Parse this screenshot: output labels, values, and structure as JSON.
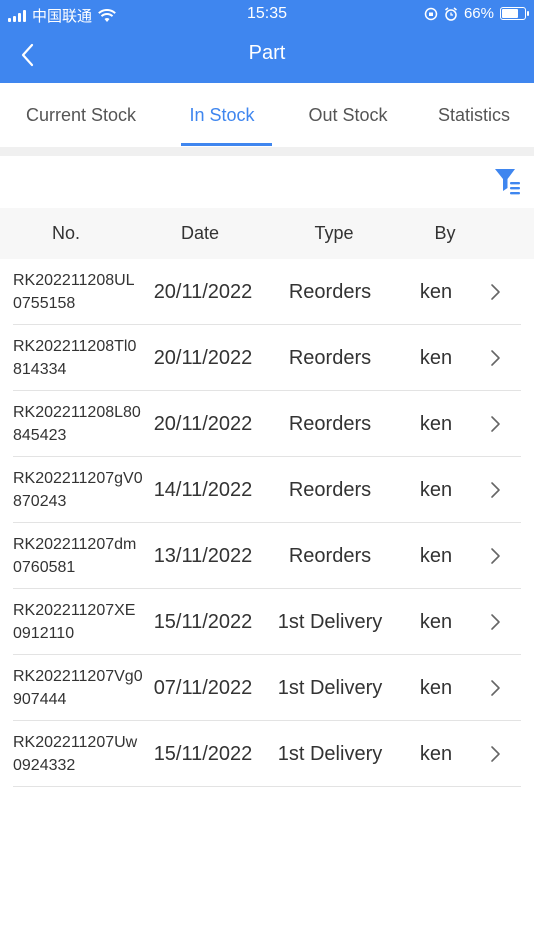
{
  "status_bar": {
    "carrier": "中国联通",
    "time": "15:35",
    "battery": "66%",
    "battery_level": 0.66
  },
  "header": {
    "title": "Part",
    "accent_color": "#3f86ef"
  },
  "tabs": [
    {
      "label": "Current Stock",
      "active": false
    },
    {
      "label": "In Stock",
      "active": true
    },
    {
      "label": "Out Stock",
      "active": false
    },
    {
      "label": "Statistics",
      "active": false
    }
  ],
  "table": {
    "columns": [
      "No.",
      "Date",
      "Type",
      "By"
    ],
    "rows": [
      {
        "no": "RK202211208UL0755158",
        "date": "20/11/2022",
        "type": "Reorders",
        "by": "ken"
      },
      {
        "no": "RK202211208Tl0814334",
        "date": "20/11/2022",
        "type": "Reorders",
        "by": "ken"
      },
      {
        "no": "RK202211208L80845423",
        "date": "20/11/2022",
        "type": "Reorders",
        "by": "ken"
      },
      {
        "no": "RK202211207gV0870243",
        "date": "14/11/2022",
        "type": "Reorders",
        "by": "ken"
      },
      {
        "no": "RK202211207dm0760581",
        "date": "13/11/2022",
        "type": "Reorders",
        "by": "ken"
      },
      {
        "no": "RK202211207XE0912110",
        "date": "15/11/2022",
        "type": "1st Delivery",
        "by": "ken"
      },
      {
        "no": "RK202211207Vg0907444",
        "date": "07/11/2022",
        "type": "1st Delivery",
        "by": "ken"
      },
      {
        "no": "RK202211207Uw0924332",
        "date": "15/11/2022",
        "type": "1st Delivery",
        "by": "ken"
      }
    ]
  },
  "icons": {
    "back": "chevron-left-icon",
    "filter": "filter-icon",
    "row_arrow": "chevron-right-icon"
  }
}
